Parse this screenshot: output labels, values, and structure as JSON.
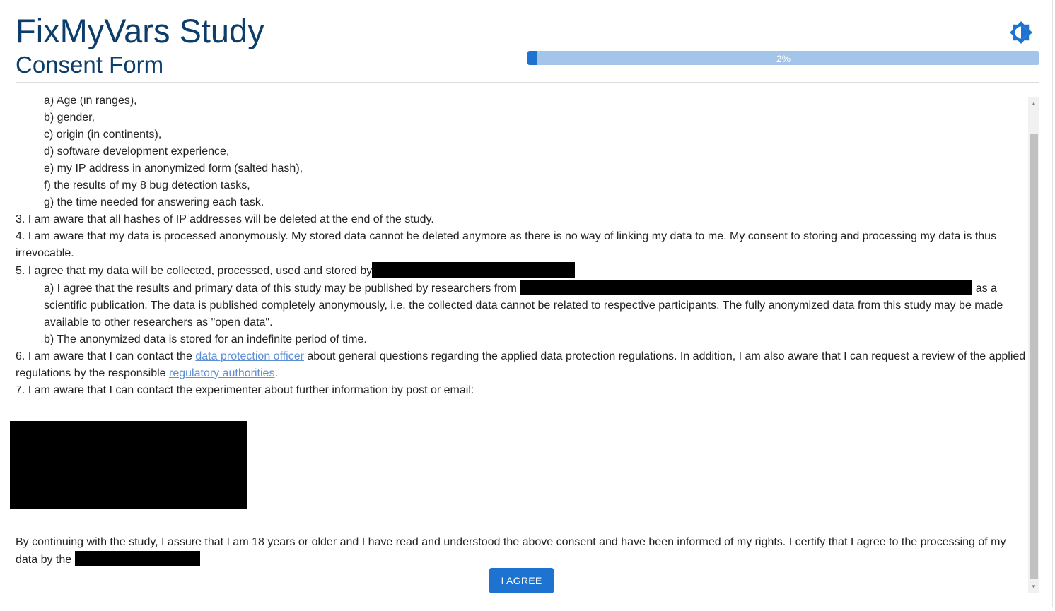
{
  "header": {
    "title": "FixMyVars Study",
    "subtitle": "Consent Form",
    "progress_label": "2%",
    "progress_fraction": 0.02,
    "theme_icon": "brightness-icon"
  },
  "consent": {
    "items_a_g": [
      "a) Age (in ranges),",
      "b) gender,",
      "c) origin (in continents),",
      "d) software development experience,",
      "e) my IP address in anonymized form (salted hash),",
      "f) the results of my 8 bug detection tasks,",
      "g) the time needed for answering each task."
    ],
    "item3": "3. I am aware that all hashes of IP addresses will be deleted at the end of the study.",
    "item4": "4. I am aware that my data is processed anonymously. My stored data cannot be deleted anymore as there is no way of linking my data to me. My consent to storing and processing my data is thus irrevocable.",
    "item5": "5. I agree that my data will be collected, processed, used and stored by",
    "item5a_pre": "a) I agree that the results and primary data of this study may be published by researchers from",
    "item5a_post": "as a scientific publication. The data is published completely anonymously, i.e. the collected data cannot be related to respective participants. The fully anonymized data from this study may be made available to other researchers as \"open data\".",
    "item5b": "b) The anonymized data is stored for an indefinite period of time.",
    "item6_pre": "6. I am aware that I can contact the",
    "item6_link1": "data protection officer",
    "item6_mid": "about general questions regarding the applied data protection regulations. In addition, I am also aware that I can request a review of the applied regulations by the responsible",
    "item6_link2": "regulatory authorities",
    "item6_post": ".",
    "item7": "7. I am aware that I can contact the experimenter about further information by post or email:",
    "final_pre": "By continuing with the study, I assure that I am 18 years or older and I have read and understood the above consent and have been informed of my rights. I certify that I agree to the processing of my data by the"
  },
  "actions": {
    "agree_label": "I AGREE"
  },
  "colors": {
    "title": "#0d3d6b",
    "accent": "#1f73d0",
    "progress_track": "#a4c5ea",
    "link": "#5b8fd6"
  }
}
